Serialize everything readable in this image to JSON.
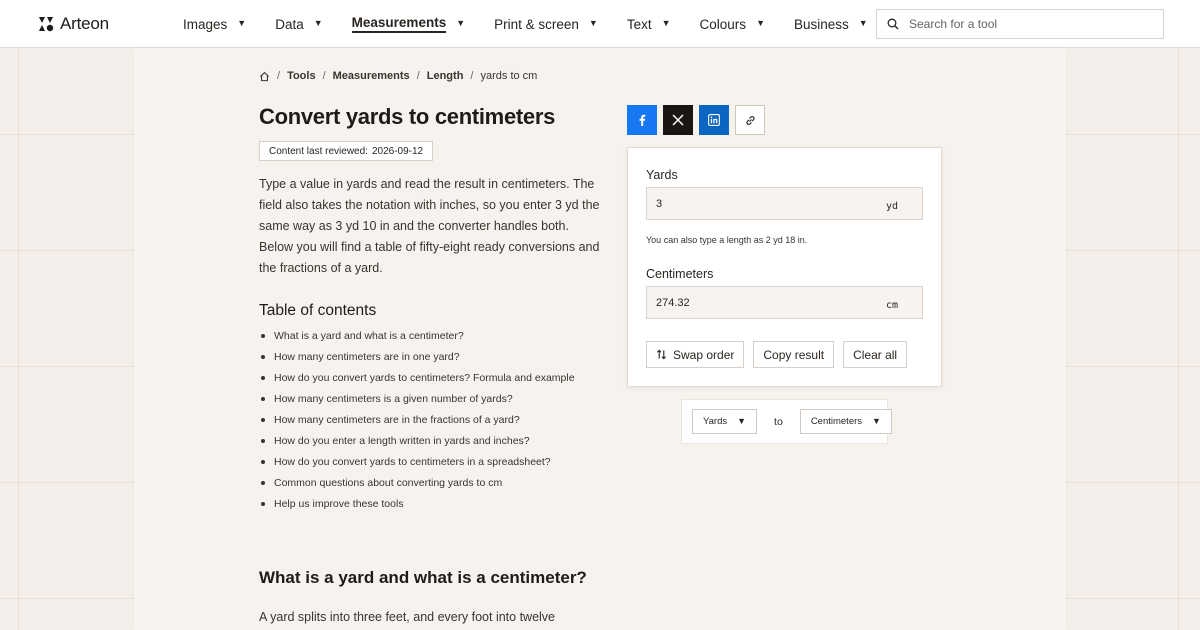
{
  "brand": {
    "name": "Arteon"
  },
  "nav": {
    "items": [
      {
        "label": "Images"
      },
      {
        "label": "Data"
      },
      {
        "label": "Measurements"
      },
      {
        "label": "Print & screen"
      },
      {
        "label": "Text"
      },
      {
        "label": "Colours"
      },
      {
        "label": "Business"
      }
    ],
    "active": "Measurements"
  },
  "search": {
    "placeholder": "Search for a tool"
  },
  "breadcrumb": {
    "items": [
      "Tools",
      "Measurements",
      "Length"
    ],
    "current": "yards to cm"
  },
  "page": {
    "title": "Convert yards to centimeters",
    "reviewed_label": "Content last reviewed:",
    "reviewed_date": "2026-09-12",
    "intro": "Type a value in yards and read the result in centimeters. The field also takes the notation with inches, so you enter 3 yd the same way as 3 yd 10 in and the converter handles both. Below you will find a table of fifty-eight ready conversions and the fractions of a yard."
  },
  "toc": {
    "title": "Table of contents",
    "items": [
      "What is a yard and what is a centimeter?",
      "How many centimeters are in one yard?",
      "How do you convert yards to centimeters? Formula and example",
      "How many centimeters is a given number of yards?",
      "How many centimeters are in the fractions of a yard?",
      "How do you enter a length written in yards and inches?",
      "How do you convert yards to centimeters in a spreadsheet?",
      "Common questions about converting yards to cm",
      "Help us improve these tools"
    ]
  },
  "section": {
    "title": "What is a yard and what is a centimeter?",
    "text": "A yard splits into three feet, and every foot into twelve"
  },
  "converter": {
    "from_label": "Yards",
    "from_value": "3",
    "from_unit": "yd",
    "hint": "You can also type a length as 2 yd 18 in.",
    "to_label": "Centimeters",
    "to_value": "274.32",
    "to_unit": "cm",
    "swap_label": "Swap order",
    "copy_label": "Copy result",
    "clear_label": "Clear all"
  },
  "units": {
    "from": "Yards",
    "connector": "to",
    "to": "Centimeters"
  },
  "colors": {
    "facebook": "#1877f2",
    "x": "#1a1614",
    "linkedin": "#0a66c2",
    "background": "#f4efea"
  }
}
